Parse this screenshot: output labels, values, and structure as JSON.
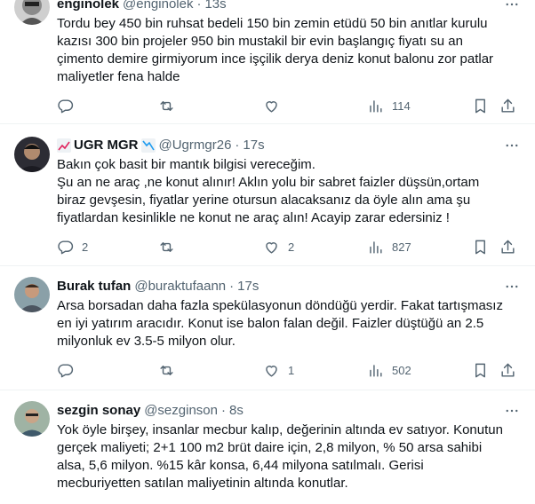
{
  "tweets": [
    {
      "name": "enginolek",
      "handle": "@enginolek",
      "time": "13s",
      "text": "Tordu bey 450 bin ruhsat bedeli 150 bin zemin etüdü 50 bin anıtlar kurulu\nkazısı 300 bin projeler 950 bin mustakil bir evin başlangıç fiyatı su an\nçimento demire girmiyorum ince işçilik derya deniz konut balonu zor patlar\nmaliyetler fena halde",
      "replies": "",
      "retweets": "",
      "likes": "",
      "views": "114"
    },
    {
      "name": "UGR MGR",
      "handle": "@Ugrmgr26",
      "time": "17s",
      "text": "Bakın çok basit bir mantık bilgisi vereceğim.\nŞu an ne araç ,ne konut alınır! Aklın yolu bir sabret faizler düşsün,ortam\nbiraz gevşesin, fiyatlar yerine otursun alacaksanız da öyle alın ama şu\nfiyatlardan kesinlikle ne konut ne araç alın! Acayip zarar edersiniz !",
      "replies": "2",
      "retweets": "",
      "likes": "2",
      "views": "827"
    },
    {
      "name": "Burak tufan",
      "handle": "@buraktufaann",
      "time": "17s",
      "text": "Arsa borsadan daha fazla spekülasyonun döndüğü yerdir. Fakat tartışmasız\nen iyi yatırım aracıdır. Konut ise balon falan değil. Faizler düştüğü an 2.5\nmilyonluk ev 3.5-5 milyon olur.",
      "replies": "",
      "retweets": "",
      "likes": "1",
      "views": "502"
    },
    {
      "name": "sezgin sonay",
      "handle": "@sezginson",
      "time": "8s",
      "text": "Yok öyle birşey, insanlar mecbur kalıp, değerinin altında ev satıyor. Konutun\ngerçek maliyeti; 2+1 100 m2 brüt daire için, 2,8 milyon, % 50 arsa sahibi\nalsa, 5,6 milyon. %15 kâr konsa, 6,44 milyona satılmalı. Gerisi\nmecburiyetten satılan maliyetinin altında konutlar."
    }
  ],
  "colors": {
    "text": "#0f1419",
    "secondary": "#536471",
    "divider": "#eff3f4"
  },
  "icons": [
    "reply-icon",
    "retweet-icon",
    "like-icon",
    "views-icon",
    "bookmark-icon",
    "share-icon",
    "more-icon",
    "chart-up-emoji",
    "chart-down-emoji"
  ]
}
